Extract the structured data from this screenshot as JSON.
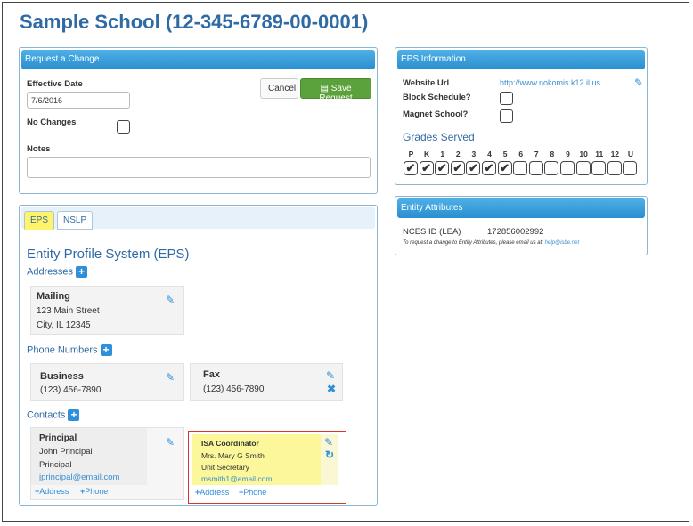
{
  "page": {
    "title": "Sample School (12-345-6789-00-0001)"
  },
  "request": {
    "header": "Request a Change",
    "effective_date_label": "Effective Date",
    "effective_date_value": "7/6/2016",
    "no_changes_label": "No Changes",
    "notes_label": "Notes",
    "cancel_label": "Cancel",
    "save_label": "Save Request"
  },
  "eps_info": {
    "header": "EPS Information",
    "website_label": "Website Url",
    "website_value": "http://www.nokomis.k12.il.us",
    "block_label": "Block Schedule?",
    "magnet_label": "Magnet School?",
    "grades_title": "Grades Served",
    "grades": [
      "P",
      "K",
      "1",
      "2",
      "3",
      "4",
      "5",
      "6",
      "7",
      "8",
      "9",
      "10",
      "11",
      "12",
      "U"
    ],
    "grades_checked": [
      true,
      true,
      true,
      true,
      true,
      true,
      true,
      false,
      false,
      false,
      false,
      false,
      false,
      false,
      false
    ]
  },
  "attributes": {
    "header": "Entity Attributes",
    "nces_label": "NCES ID (LEA)",
    "nces_value": "172856002992",
    "note_text": "To request a change to Entity Attributes, please email us at:",
    "note_email": "help@isbe.net"
  },
  "tabs": {
    "eps": "EPS",
    "nslp": "NSLP"
  },
  "eps": {
    "title": "Entity Profile System (EPS)",
    "addresses_label": "Addresses",
    "mailing": {
      "type": "Mailing",
      "line1": "123 Main Street",
      "line2": "City, IL 12345"
    },
    "phones_label": "Phone Numbers",
    "business": {
      "type": "Business",
      "number": "(123) 456-7890"
    },
    "fax": {
      "type": "Fax",
      "number": "(123) 456-7890"
    },
    "contacts_label": "Contacts",
    "principal": {
      "role": "Principal",
      "name": "John Principal",
      "title": "Principal",
      "email": "jprincipal@email.com"
    },
    "isa": {
      "role": "ISA Coordinator",
      "name": "Mrs. Mary G Smith",
      "title": "Unit Secretary",
      "email": "msmith1@email.com"
    },
    "add_address": "Address",
    "add_phone": "Phone"
  },
  "icons": {
    "edit": "pencil-icon",
    "delete": "x-icon",
    "undo": "undo-icon",
    "add": "plus-icon"
  }
}
